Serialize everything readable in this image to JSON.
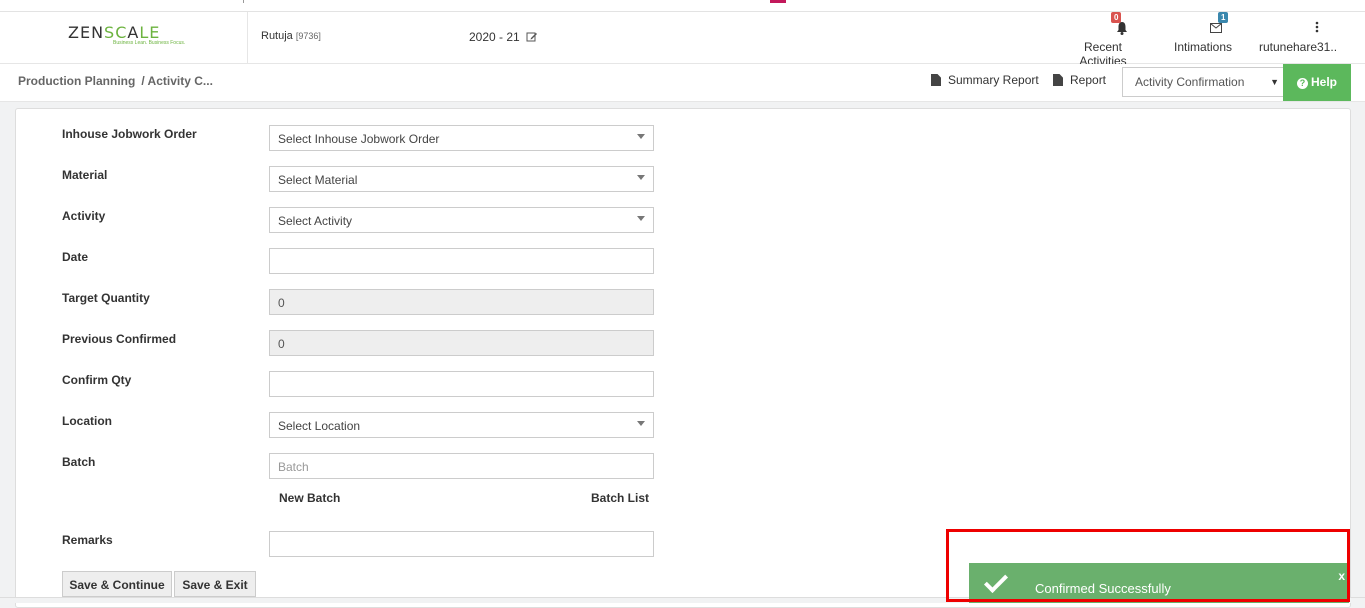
{
  "app": {
    "logo_text_a": "ZEN",
    "logo_text_b": "SC",
    "logo_text_c": "A",
    "logo_text_d": "LE",
    "logo_tagline": "Business Lean. Business Focus."
  },
  "header": {
    "user_name": "Rutuja",
    "user_code": "[9736]",
    "fiscal_year": "2020 - 21",
    "recent_label": "Recent Activities",
    "recent_count": "0",
    "intimations_label": "Intimations",
    "intimations_count": "1",
    "account_label": "rutunehare31.."
  },
  "bar": {
    "crumb_root": "Production Planning",
    "crumb_current": "/ Activity C...",
    "summary_report": "Summary Report",
    "report": "Report",
    "page_select": "Activity Confirmation",
    "help": "Help"
  },
  "form": {
    "jobwork_label": "Inhouse Jobwork Order",
    "jobwork_value": "Select Inhouse Jobwork Order",
    "material_label": "Material",
    "material_value": "Select Material",
    "activity_label": "Activity",
    "activity_value": "Select Activity",
    "date_label": "Date",
    "date_value": "",
    "target_label": "Target Quantity",
    "target_value": "0",
    "prev_label": "Previous Confirmed",
    "prev_value": "0",
    "confirm_label": "Confirm Qty",
    "confirm_value": "",
    "location_label": "Location",
    "location_value": "Select Location",
    "batch_label": "Batch",
    "batch_placeholder": "Batch",
    "new_batch": "New Batch",
    "batch_list": "Batch List",
    "remarks_label": "Remarks",
    "remarks_value": "",
    "save_continue": "Save & Continue",
    "save_exit": "Save & Exit"
  },
  "toast": {
    "message": "Confirmed Successfully",
    "close": "x"
  },
  "colors": {
    "brand_green": "#6cb33f",
    "help_green": "#5cb85c",
    "toast_green": "#6ab06d",
    "highlight_red": "#e00000"
  }
}
